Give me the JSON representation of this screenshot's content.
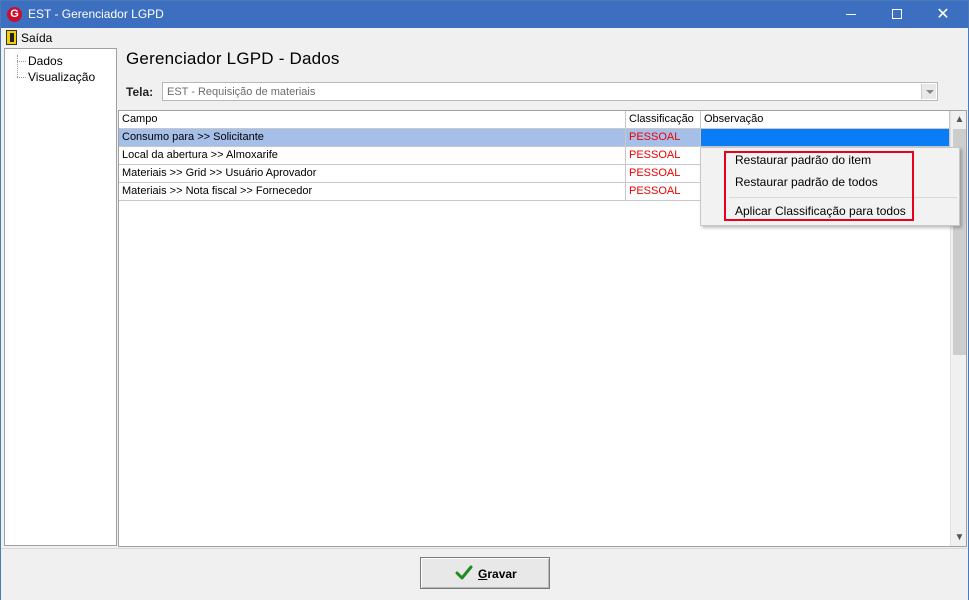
{
  "window": {
    "title": "EST - Gerenciador LGPD",
    "logo_letter": "G",
    "accent_color": "#3c6fbf"
  },
  "menu": {
    "exit_label": "Saída"
  },
  "tree": {
    "items": [
      {
        "label": "Dados"
      },
      {
        "label": "Visualização"
      }
    ]
  },
  "page": {
    "title": "Gerenciador LGPD - Dados",
    "screen_label": "Tela:",
    "screen_value": "EST - Requisição de materiais"
  },
  "grid": {
    "columns": [
      "Campo",
      "Classificação",
      "Observação"
    ],
    "rows": [
      {
        "campo": "Consumo para >> Solicitante",
        "classificacao": "PESSOAL",
        "observacao": "",
        "selected": true
      },
      {
        "campo": "Local da abertura >> Almoxarife",
        "classificacao": "PESSOAL",
        "observacao": ""
      },
      {
        "campo": "Materiais >> Grid >> Usuário Aprovador",
        "classificacao": "PESSOAL",
        "observacao": ""
      },
      {
        "campo": "Materiais >> Nota fiscal >> Fornecedor",
        "classificacao": "PESSOAL",
        "observacao": ""
      }
    ],
    "classification_color": "#ee0000",
    "selected_row_color": "#a6bfe8",
    "selected_cell_color": "#0a7cf6"
  },
  "context_menu": {
    "items": [
      "Restaurar padrão do item",
      "Restaurar padrão de todos",
      "Aplicar Classificação para todos"
    ],
    "highlight_color": "#e8001c"
  },
  "footer": {
    "save_mnemonic": "G",
    "save_rest": "ravar",
    "save_icon": "checkmark-icon",
    "save_icon_color": "#1e8c1e"
  }
}
